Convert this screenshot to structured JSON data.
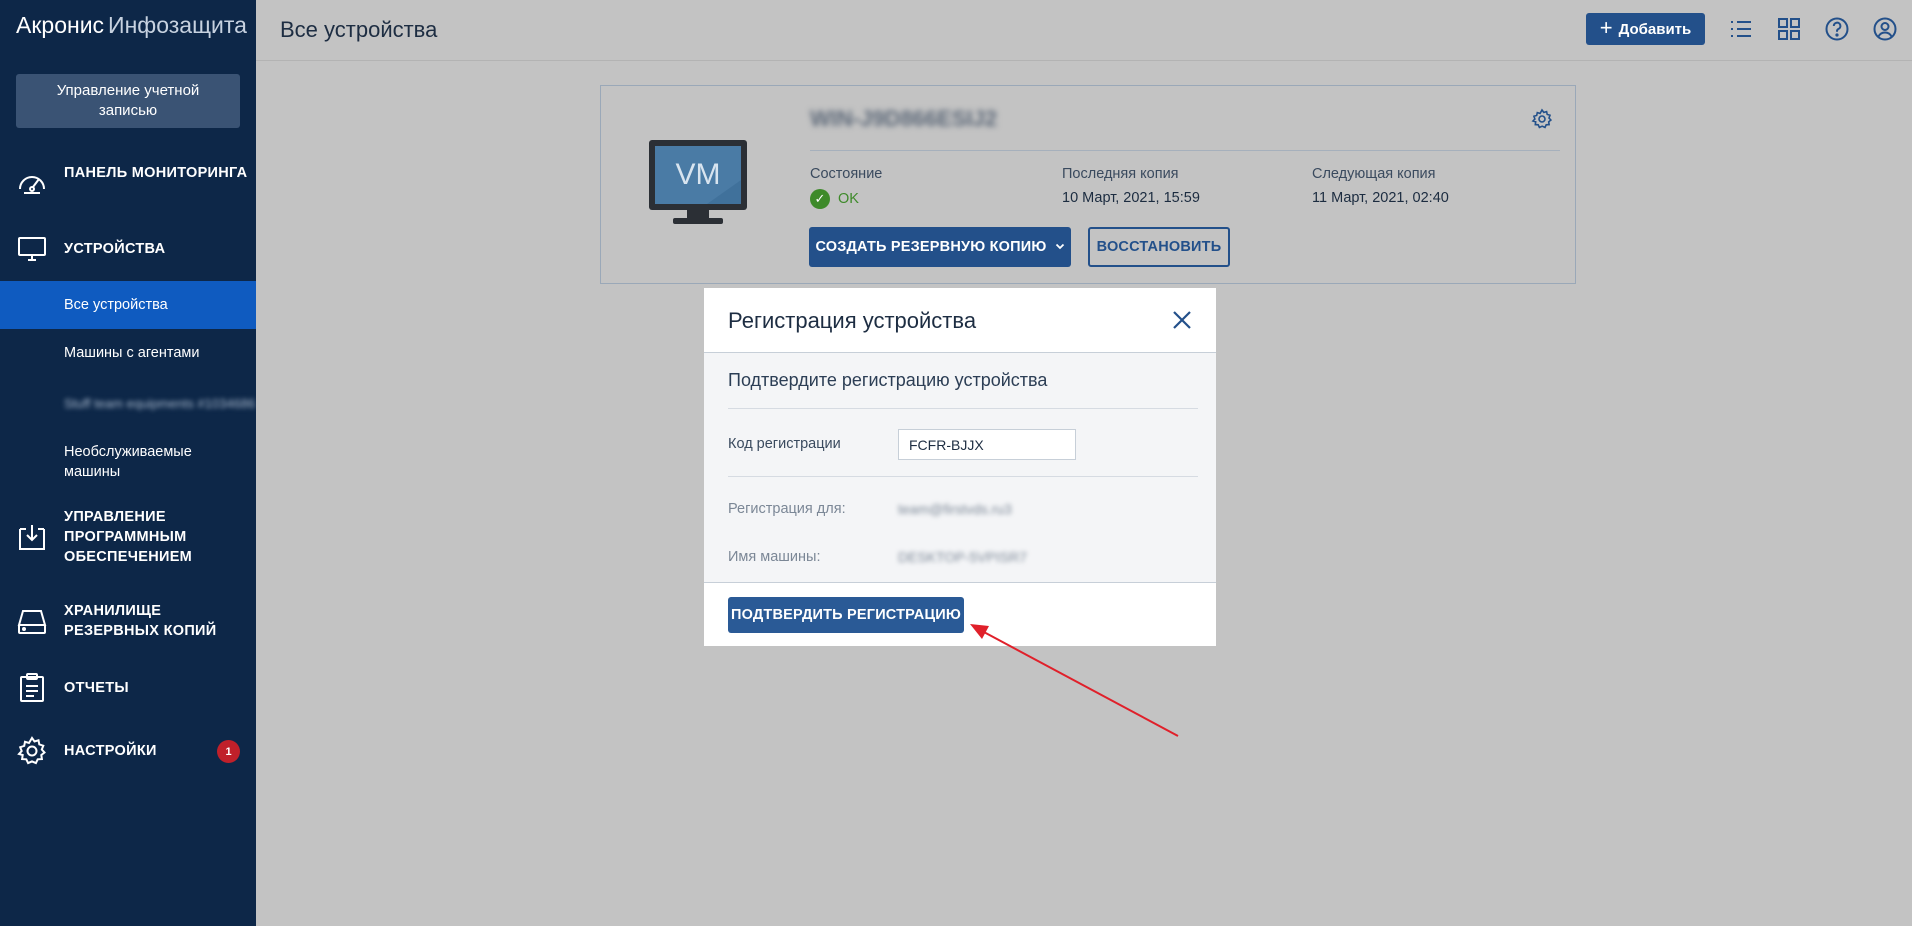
{
  "app": {
    "brand_main": "Акронис",
    "brand_sub": "Инфозащита"
  },
  "sidebar": {
    "account_button": "Управление учетной записью",
    "items": [
      {
        "label": "ПАНЕЛЬ МОНИТОРИНГА",
        "icon": "dashboard-icon"
      },
      {
        "label": "УСТРОЙСТВА",
        "icon": "monitor-icon"
      },
      {
        "label": "УПРАВЛЕНИЕ ПРОГРАММНЫМ ОБЕСПЕЧЕНИЕМ",
        "icon": "software-download-icon"
      },
      {
        "label": "ХРАНИЛИЩЕ РЕЗЕРВНЫХ КОПИЙ",
        "icon": "storage-drive-icon"
      },
      {
        "label": "ОТЧЕТЫ",
        "icon": "clipboard-icon"
      },
      {
        "label": "НАСТРОЙКИ",
        "icon": "gear-icon",
        "badge": "1"
      }
    ],
    "sub_items": [
      {
        "label": "Все устройства",
        "active": true
      },
      {
        "label": "Машины с агентами"
      },
      {
        "label": "Stuff team equipments #1034686",
        "blurred": true
      },
      {
        "label": "Необслуживаемые машины"
      }
    ]
  },
  "header": {
    "title": "Все устройства",
    "add_button": "Добавить",
    "icons": [
      "list-view-icon",
      "grid-view-icon",
      "help-icon",
      "user-account-icon"
    ]
  },
  "device_card": {
    "monitor_label": "VM",
    "device_name": "WIN-J9D866ESIJ2",
    "status_label": "Состояние",
    "status_value": "OK",
    "last_backup_label": "Последняя копия",
    "last_backup_value": "10 Март, 2021, 15:59",
    "next_backup_label": "Следующая копия",
    "next_backup_value": "11 Март, 2021, 02:40",
    "backup_button": "СОЗДАТЬ РЕЗЕРВНУЮ КОПИЮ",
    "restore_button": "ВОССТАНОВИТЬ"
  },
  "modal": {
    "title": "Регистрация устройства",
    "subtitle": "Подтвердите регистрацию устройства",
    "code_label": "Код регистрации",
    "code_value": "FCFR-BJJX",
    "registration_for_label": "Регистрация для:",
    "registration_for_value": "team@firstvds.ru3",
    "machine_name_label": "Имя машины:",
    "machine_name_value": "DESKTOP-5VPISR7",
    "confirm_button": "ПОДТВЕРДИТЬ РЕГИСТРАЦИЮ"
  },
  "colors": {
    "sidebar": "#0d2748",
    "accent": "#23508a",
    "active": "#0f5bc0",
    "ok": "#3e8a2a",
    "badge": "#c0202a",
    "arrow": "#e0202a"
  }
}
